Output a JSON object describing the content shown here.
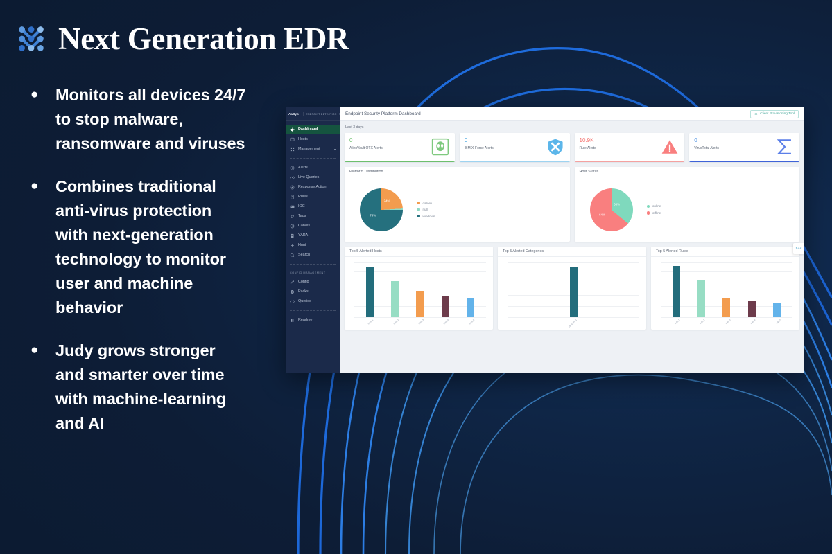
{
  "slide": {
    "title": "Next Generation EDR",
    "logo_icon": "dot-grid-logo-icon",
    "bullets": [
      "Monitors all devices 24/7 to stop malware, ransomware and viruses",
      "Combines traditional anti-virus protection with next-generation technology to monitor user and machine behavior",
      "Judy grows stronger and smarter over time with machine-learning and AI"
    ],
    "bullet_marker": "●",
    "colors": {
      "background": "#0f2545",
      "accent_blue": "#1f6fe0",
      "logo_blue": "#3f82d6",
      "text": "#ffffff"
    }
  },
  "app": {
    "sidebar": {
      "logo": "AaDyo",
      "divider": "|",
      "subtitle": "ENDPOINT DETECTION",
      "collapse_icon": "chevron-left-icon",
      "items": [
        {
          "label": "Dashboard",
          "icon": "dashboard-icon",
          "active": true
        },
        {
          "label": "Hosts",
          "icon": "monitor-icon",
          "active": false
        },
        {
          "label": "Management",
          "icon": "grid-icon",
          "active": false,
          "chevron": "▾"
        }
      ],
      "items2": [
        {
          "label": "Alerts",
          "icon": "info-circle-icon"
        },
        {
          "label": "Live Queries",
          "icon": "code-brackets-icon"
        },
        {
          "label": "Response Action",
          "icon": "target-icon"
        },
        {
          "label": "Rules",
          "icon": "clipboard-icon"
        },
        {
          "label": "IOC",
          "icon": "card-icon"
        },
        {
          "label": "Tags",
          "icon": "tag-icon"
        },
        {
          "label": "Carves",
          "icon": "gear-icon"
        },
        {
          "label": "YARA",
          "icon": "file-icon"
        },
        {
          "label": "Hunt",
          "icon": "crosshair-icon"
        },
        {
          "label": "Search",
          "icon": "search-icon"
        }
      ],
      "group_title": "CONFIG MANAGEMENT",
      "items3": [
        {
          "label": "Config",
          "icon": "nodes-icon"
        },
        {
          "label": "Packs",
          "icon": "package-icon"
        },
        {
          "label": "Queries",
          "icon": "code-brackets-icon"
        }
      ],
      "items4": [
        {
          "label": "Readme",
          "icon": "book-icon"
        }
      ]
    },
    "topbar": {
      "title": "Endpoint Security Platform Dashboard",
      "provisioning_button": "Client Provisioning Tool",
      "provisioning_icon": "cloud-download-icon"
    },
    "range_label": "Last 3 days",
    "kpis": [
      {
        "value": "0",
        "label": "AlienVault OTX Alerts",
        "color": "#6dbf6d",
        "icon": "alien-icon"
      },
      {
        "value": "0",
        "label": "IBM X-Force Alerts",
        "color": "#4aa8e0",
        "icon": "shield-x-icon"
      },
      {
        "value": "10.9K",
        "label": "Rule Alerts",
        "color": "#f4736f",
        "icon": "warning-triangle-icon"
      },
      {
        "value": "0",
        "label": "VirusTotal Alerts",
        "color": "#4a6ee0",
        "icon": "sigma-icon"
      }
    ],
    "code_badge_icon": "code-embed-icon"
  },
  "chart_data": [
    {
      "type": "pie",
      "title": "Platform Distribution",
      "categories": [
        "darwin",
        "null",
        "windows"
      ],
      "values": [
        24,
        1,
        75
      ],
      "labels": [
        "24%",
        "",
        "75%"
      ],
      "colors": [
        "#f39c4e",
        "#8fd9c4",
        "#25707e"
      ],
      "legend": "right"
    },
    {
      "type": "pie",
      "title": "Host Status",
      "categories": [
        "online",
        "offline"
      ],
      "values": [
        36,
        64
      ],
      "labels": [
        "36%",
        "64%"
      ],
      "colors": [
        "#7fd9bd",
        "#f97f7f"
      ],
      "legend": "right"
    },
    {
      "type": "bar",
      "title": "Top 5 Alerted Hosts",
      "categories": [
        "host-1",
        "host-2",
        "host-3",
        "host-4",
        "host-5"
      ],
      "values": [
        100,
        72,
        52,
        42,
        38
      ],
      "colors": [
        "#236d7c",
        "#97ddc4",
        "#f39c4e",
        "#6d3b4b",
        "#63b3ea"
      ],
      "ylim": [
        0,
        100
      ],
      "grid": true
    },
    {
      "type": "bar",
      "title": "Top 5 Alerted Categories",
      "categories": [
        "category-1"
      ],
      "values": [
        100
      ],
      "colors": [
        "#236d7c"
      ],
      "ylim": [
        0,
        100
      ],
      "grid": true
    },
    {
      "type": "bar",
      "title": "Top 5 Alerted Rules",
      "categories": [
        "rule-1",
        "rule-2",
        "rule-3",
        "rule-4",
        "rule-5"
      ],
      "values": [
        100,
        73,
        38,
        33,
        29
      ],
      "colors": [
        "#236d7c",
        "#97ddc4",
        "#f39c4e",
        "#6d3b4b",
        "#63b3ea"
      ],
      "ylim": [
        0,
        100
      ],
      "grid": true
    }
  ]
}
